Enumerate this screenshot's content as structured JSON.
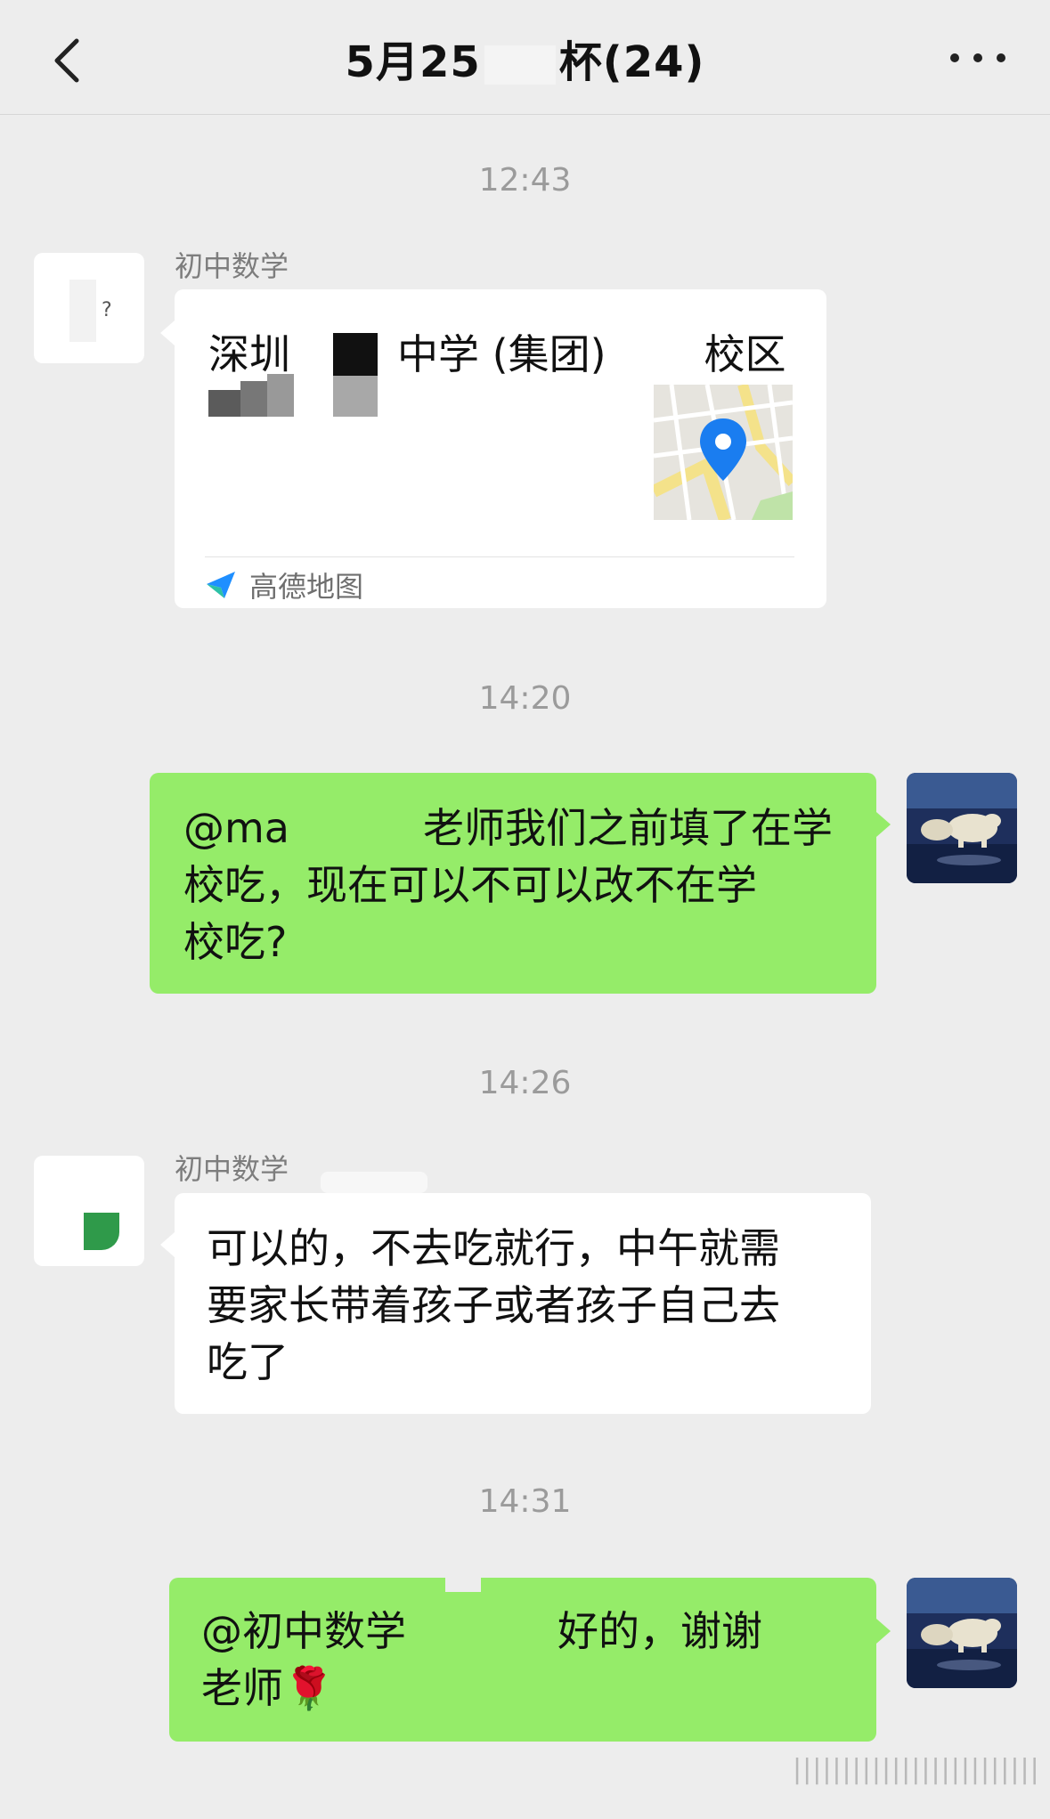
{
  "header": {
    "title_left": "5月25",
    "title_right": "杯(24)",
    "back_icon": "chevron-left-icon",
    "more_icon": "more-dots-icon"
  },
  "messages": [
    {
      "type": "timestamp",
      "text": "12:43"
    },
    {
      "type": "location",
      "side": "left",
      "sender": "初中数学",
      "location_name_part1": "深圳",
      "location_name_part2": "中学 (集团)",
      "location_name_part3": "校区",
      "app_name": "高德地图",
      "app_icon": "amap-logo-icon",
      "map_icon": "map-pin-icon"
    },
    {
      "type": "timestamp",
      "text": "14:20"
    },
    {
      "type": "text",
      "side": "right",
      "text_line1": "@ma",
      "text_line1b": "老师我们之前填了在学",
      "text_line2": "校吃，现在可以不可以改不在学",
      "text_line3": "校吃?"
    },
    {
      "type": "timestamp",
      "text": "14:26"
    },
    {
      "type": "text",
      "side": "left",
      "sender": "初中数学",
      "text": "可以的，不去吃就行，中午就需\n要家长带着孩子或者孩子自己去\n吃了"
    },
    {
      "type": "timestamp",
      "text": "14:31"
    },
    {
      "type": "text",
      "side": "right",
      "text_part1": "@初中数学",
      "text_part2": "好的，谢谢",
      "text_line2": "老师",
      "emoji": "🌹"
    }
  ],
  "colors": {
    "background": "#ededed",
    "bubble_self": "#95ec69",
    "bubble_other": "#ffffff",
    "map_pin": "#1a7df0"
  },
  "watermark": "|||||||||||||||||||||||||"
}
